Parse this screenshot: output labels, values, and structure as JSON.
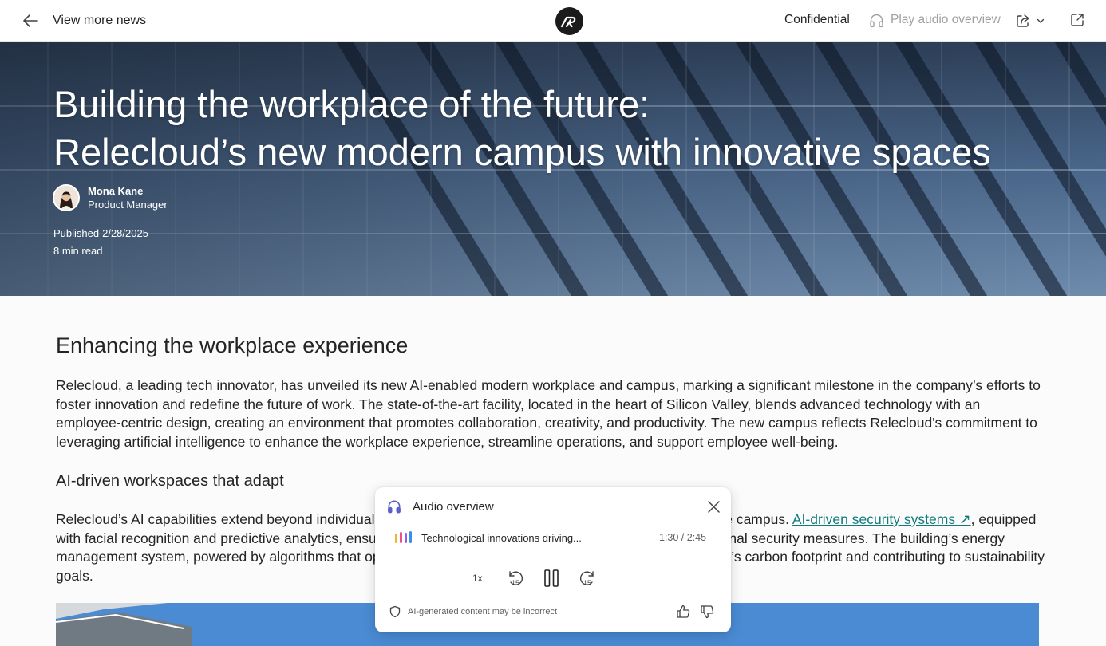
{
  "header": {
    "back_label": "View more news",
    "confidential_label": "Confidential",
    "play_audio_label": "Play audio overview"
  },
  "hero": {
    "title_line1": "Building the workplace of the future:",
    "title_line2": "Relecloud’s new modern campus with innovative spaces",
    "author_name": "Mona Kane",
    "author_role": "Product Manager",
    "published_label": "Published",
    "published_date": "2/28/2025",
    "read_time": "8 min read"
  },
  "article": {
    "heading": "Enhancing the workplace experience",
    "paragraph1": "Relecloud, a leading tech innovator, has unveiled its new AI-enabled modern workplace and campus, marking a significant milestone in the company’s efforts to foster innovation and redefine the future of work. The state-of-the-art facility, located in the heart of Silicon Valley, blends advanced technology with an employee-centric design, creating an environment that promotes collaboration, creativity, and productivity. The new campus reflects Relecloud's commitment to leveraging artificial intelligence to enhance the workplace experience, streamline operations, and support employee well-being.",
    "subheading": "AI-driven workspaces that adapt",
    "paragraph2_part1": "Relecloud’s AI capabilities extend beyond individual workspaces and into the infrastructure and security of the campus. ",
    "paragraph2_link": "AI-driven security systems ↗",
    "paragraph2_part2": ", equipped with facial recognition and predictive analytics, ensure a safe environment while reducing the need for traditional security measures. The building’s energy management system, powered by algorithms that optimize heating, cooling and lighting, reducing the campus’s carbon footprint and contributing to sustainability goals."
  },
  "audio_panel": {
    "title": "Audio overview",
    "track_title": "Technological innovations driving...",
    "time": "1:30 / 2:45",
    "speed": "1x",
    "skip_back": "15",
    "skip_forward": "15",
    "disclaimer": "AI-generated content may be incorrect"
  },
  "colors": {
    "link": "#0f7b7b",
    "accent_headphones": "#5b5fc7",
    "text": "#242424"
  }
}
